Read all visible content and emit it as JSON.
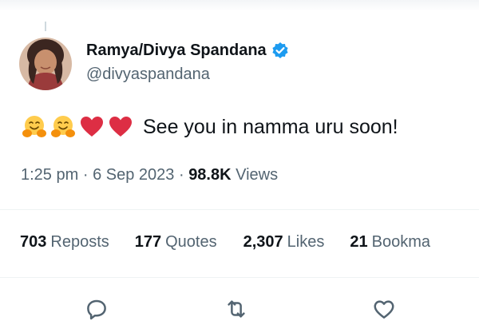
{
  "tweet": {
    "author": {
      "name": "Ramya/Divya Spandana",
      "handle": "@divyaspandana",
      "verified": true
    },
    "emojis": [
      "hugging-face-emoji",
      "hugging-face-emoji",
      "red-heart-emoji",
      "red-heart-emoji"
    ],
    "text": "See you in namma uru soon!",
    "meta": {
      "time": "1:25 pm",
      "separator": "·",
      "date": "6 Sep 2023",
      "views_count": "98.8K",
      "views_label": "Views"
    },
    "stats": [
      {
        "count": "703",
        "label": "Reposts"
      },
      {
        "count": "177",
        "label": "Quotes"
      },
      {
        "count": "2,307",
        "label": "Likes"
      },
      {
        "count": "21",
        "label": "Bookma"
      }
    ],
    "actions": [
      "reply-icon",
      "repost-icon",
      "like-icon"
    ]
  },
  "colors": {
    "text_primary": "#0f1419",
    "text_secondary": "#536471",
    "verified_blue": "#1d9bf0",
    "divider": "#eff3f4",
    "heart_red": "#dd2e44",
    "emoji_yellow": "#ffcc4d"
  }
}
